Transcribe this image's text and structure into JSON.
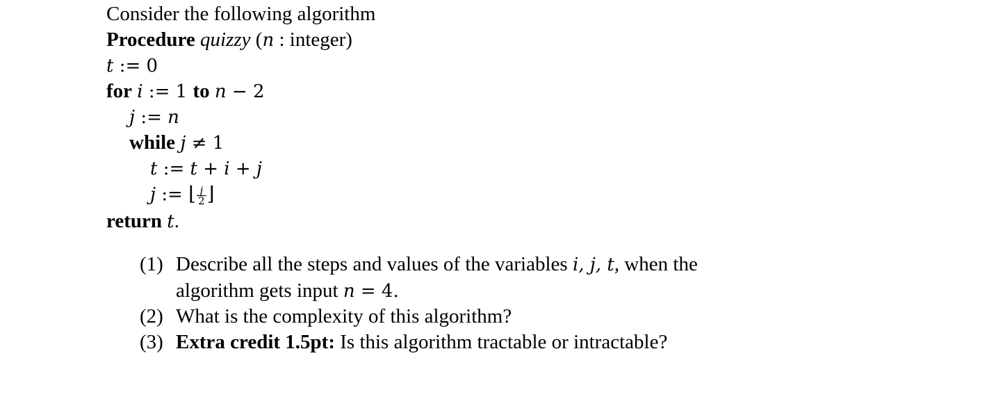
{
  "intro": "Consider the following algorithm",
  "procedure": {
    "keyword": "Procedure",
    "name": "quizzy",
    "open_paren": "(",
    "param": "n",
    "colon_type": " : integer)"
  },
  "code": {
    "init_var": "t",
    "init_assign": " := 0",
    "for_kw": "for",
    "for_var": "i",
    "for_assign": " := 1 ",
    "to_kw": "to",
    "for_end_var": "n",
    "for_end_rest": " − 2",
    "j_init_var": "j",
    "j_init_assign": " := ",
    "j_init_val": "n",
    "while_kw": "while",
    "while_var": "j",
    "while_cond": " ≠ 1",
    "t_update_lhs": "t",
    "t_update_assign": " := ",
    "t_update_rhs": "t + i + j",
    "j_update_lhs": "j",
    "j_update_assign": " := ",
    "floor_left": "⌊",
    "frac_num": "j",
    "frac_den": "2",
    "floor_right": "⌋",
    "return_kw": "return",
    "return_var": "t",
    "return_end": "."
  },
  "questions": [
    {
      "label": "(1)",
      "text_a": "Describe all the steps and values of the variables ",
      "vars": "i, j, t",
      "text_b": ", when the",
      "text_c": "algorithm gets input ",
      "math": "n",
      "text_d": " = 4."
    },
    {
      "label": "(2)",
      "text": "What is the complexity of this algorithm?"
    },
    {
      "label": "(3)",
      "bold": "Extra credit 1.5pt:",
      "text": " Is this algorithm tractable or intractable?"
    }
  ]
}
